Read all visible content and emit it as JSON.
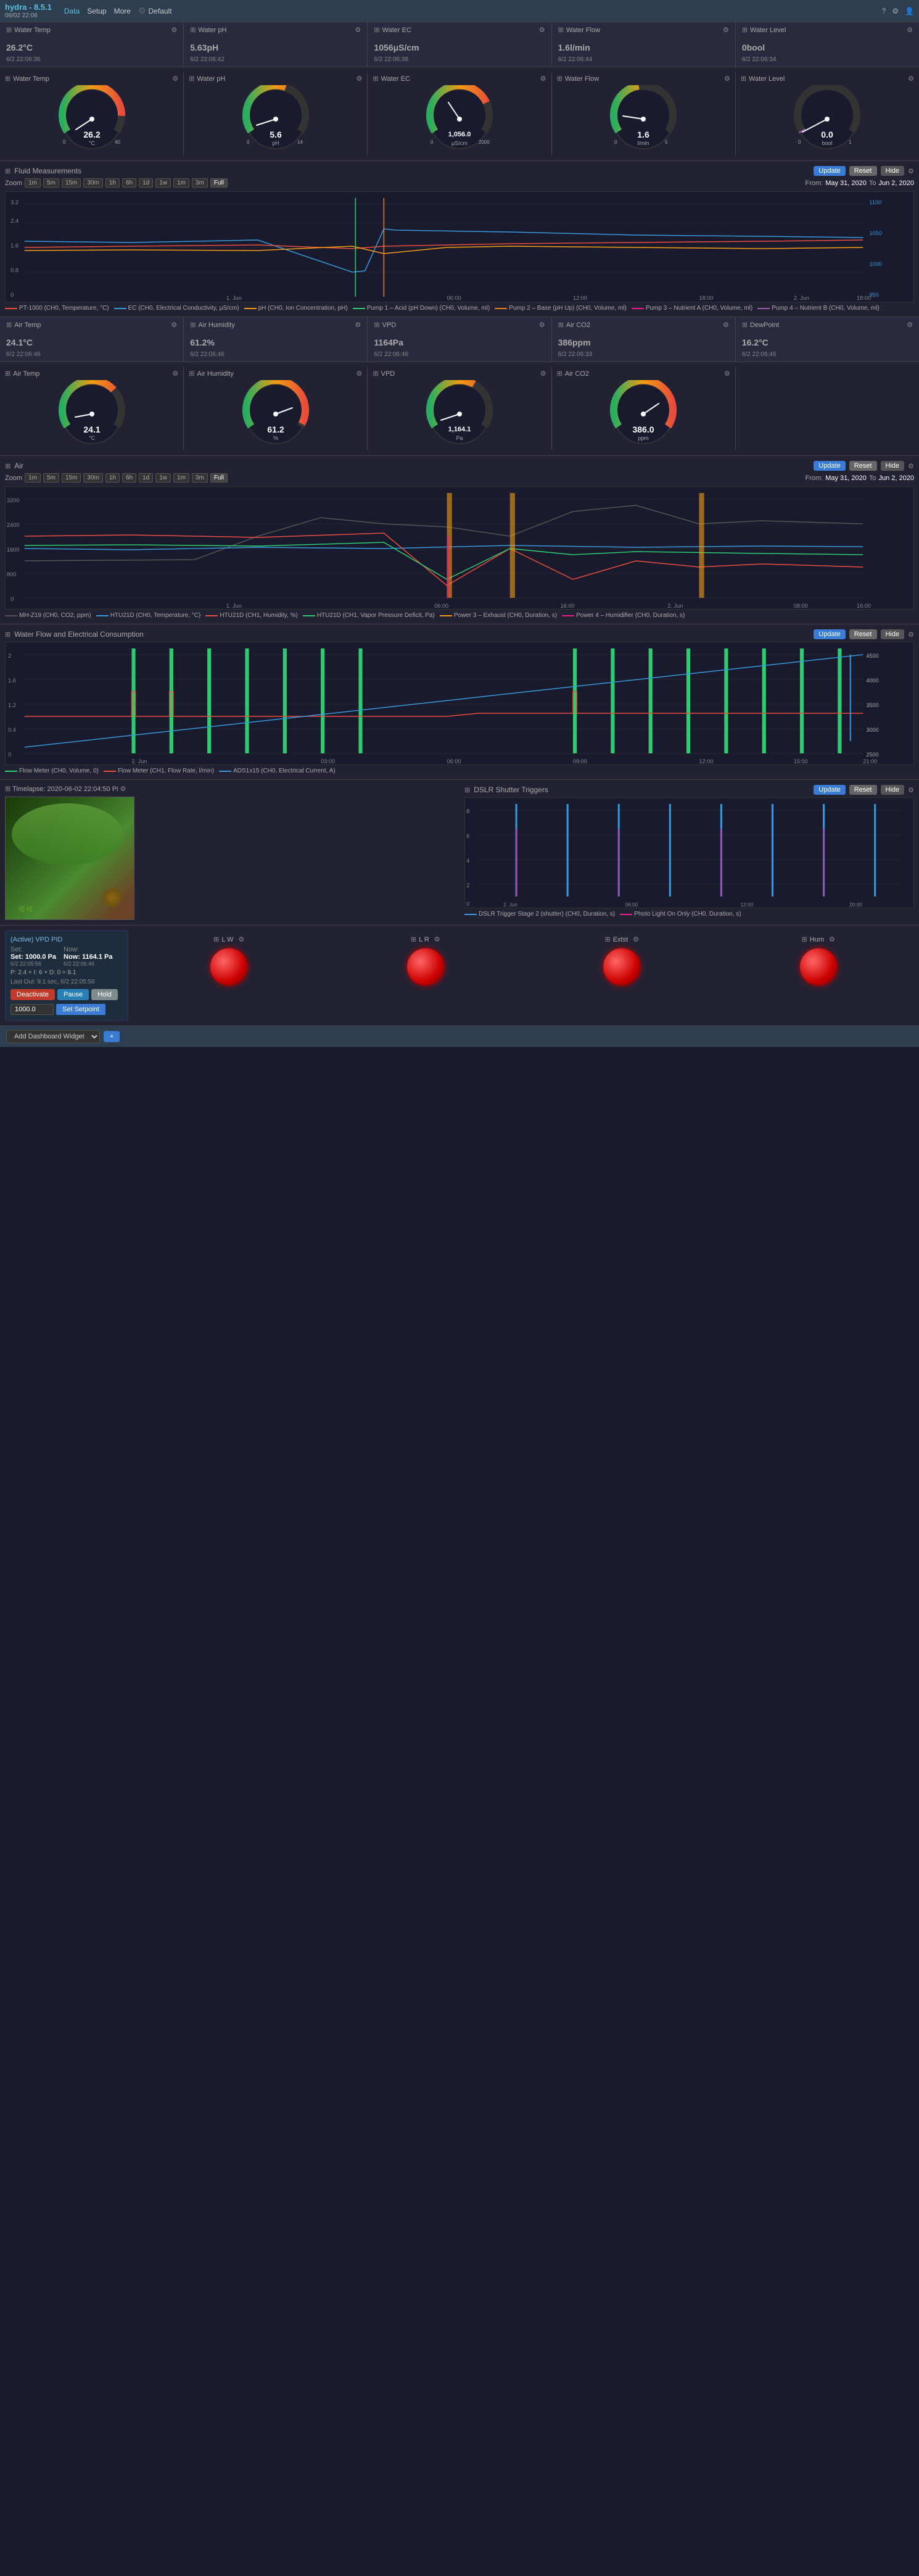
{
  "nav": {
    "brand": "hydra - 8.5.1",
    "date": "06/02 22:06",
    "data_label": "Data",
    "setup_label": "Setup",
    "more_label": "More",
    "default_label": "Default"
  },
  "top_widgets": [
    {
      "id": "water-temp",
      "label": "Water Temp",
      "value": "26.2",
      "unit": "°C",
      "time": "6/2 22:06:36"
    },
    {
      "id": "water-ph",
      "label": "Water pH",
      "value": "5.63",
      "unit": "pH",
      "time": "6/2 22:06:42"
    },
    {
      "id": "water-ec",
      "label": "Water EC",
      "value": "1056",
      "unit": "μS/cm",
      "time": "6/2 22:06:38"
    },
    {
      "id": "water-flow",
      "label": "Water Flow",
      "value": "1.6",
      "unit": "l/min",
      "time": "6/2 22:06:44"
    },
    {
      "id": "water-level",
      "label": "Water Level",
      "value": "0",
      "unit": "bool",
      "time": "6/2 22:06:34"
    }
  ],
  "gauges_water": [
    {
      "id": "g-water-temp",
      "label": "Water Temp",
      "value": "26.2",
      "min": 0,
      "max": 40,
      "color": "#e74c3c"
    },
    {
      "id": "g-water-ph",
      "label": "Water pH",
      "value": "5.6",
      "min": 0,
      "max": 14,
      "color": "#f39c12"
    },
    {
      "id": "g-water-ec",
      "label": "Water EC",
      "value": "1,056.0",
      "min": 0,
      "max": 2000,
      "color": "#3498db"
    },
    {
      "id": "g-water-flow",
      "label": "Water Flow",
      "value": "1.6",
      "min": 0,
      "max": 5,
      "color": "#2ecc71"
    },
    {
      "id": "g-water-level",
      "label": "Water Level",
      "value": "0.0",
      "min": 0,
      "max": 1,
      "color": "#9b59b6"
    }
  ],
  "fluid_chart": {
    "title": "Fluid Measurements",
    "btn_update": "Update",
    "btn_reset": "Reset",
    "btn_hide": "Hide",
    "zoom_options": [
      "1m",
      "5m",
      "15m",
      "30m",
      "1h",
      "6h",
      "1d",
      "1w",
      "1m",
      "3m",
      "Full"
    ],
    "active_zoom": "Full",
    "from": "May 31, 2020",
    "to": "Jun 2, 2020",
    "legend": [
      {
        "label": "PT-1000 (CH0, Temperature, °C)",
        "color": "#e74c3c"
      },
      {
        "label": "EC (CH0, Electrical Conductivity, μS/cm)",
        "color": "#3498db"
      },
      {
        "label": "pH (CH0, Ion Concentration, pH)",
        "color": "#f39c12"
      },
      {
        "label": "Pump 1 – Acid (pH Down) (CH0, Volume, ml)",
        "color": "#2ecc71"
      },
      {
        "label": "Pump 2 – Base (pH Up) (CH0, Volume, ml)",
        "color": "#e67e22"
      },
      {
        "label": "Pump 3 – Nutrient A (CH0, Volume, ml)",
        "color": "#e91e8c"
      },
      {
        "label": "Pump 4 – Nutrient B (CH0, Volume, ml)",
        "color": "#9b59b6"
      }
    ]
  },
  "air_widgets": [
    {
      "id": "air-temp",
      "label": "Air Temp",
      "value": "24.1",
      "unit": "°C",
      "time": "6/2 22:06:46"
    },
    {
      "id": "air-humidity",
      "label": "Air Humidity",
      "value": "61.2",
      "unit": "%",
      "time": "6/2 22:06:46"
    },
    {
      "id": "vpd",
      "label": "VPD",
      "value": "1164",
      "unit": "Pa",
      "time": "6/2 22:06:46"
    },
    {
      "id": "air-co2",
      "label": "Air CO2",
      "value": "386",
      "unit": "ppm",
      "time": "6/2 22:06:33"
    },
    {
      "id": "dewpoint",
      "label": "DewPoint",
      "value": "16.2",
      "unit": "°C",
      "time": "6/2 22:06:46"
    }
  ],
  "gauges_air": [
    {
      "id": "g-air-temp",
      "label": "Air Temp",
      "value": "24.1",
      "min": 0,
      "max": 50,
      "color": "#e74c3c"
    },
    {
      "id": "g-air-humidity",
      "label": "Air Humidity",
      "value": "61.2",
      "min": 0,
      "max": 100,
      "color": "#3498db"
    },
    {
      "id": "g-vpd",
      "label": "VPD",
      "value": "1,164.1",
      "min": 0,
      "max": 3000,
      "color": "#2ecc71"
    },
    {
      "id": "g-air-co2",
      "label": "Air CO2",
      "value": "386.0",
      "min": 0,
      "max": 600,
      "color": "#f39c12"
    }
  ],
  "air_chart": {
    "title": "Air",
    "btn_update": "Update",
    "btn_reset": "Reset",
    "btn_hide": "Hide",
    "zoom_options": [
      "1m",
      "5m",
      "15m",
      "30m",
      "1h",
      "6h",
      "1d",
      "1w",
      "1m",
      "3m",
      "Full"
    ],
    "active_zoom": "Full",
    "from": "May 31, 2020",
    "to": "Jun 2, 2020",
    "legend": [
      {
        "label": "MH-Z19 (CH0, CO2, ppm)",
        "color": "#333"
      },
      {
        "label": "HTU21D (CH0, Temperature, °C)",
        "color": "#3498db"
      },
      {
        "label": "HTU21D (CH1, Humidity, %)",
        "color": "#e74c3c"
      },
      {
        "label": "HTU21D (CH1, Vapor Pressure Deficit, Pa)",
        "color": "#2ecc71"
      },
      {
        "label": "Power 3 – Exhaust (CH0, Duration, s)",
        "color": "#f39c12"
      },
      {
        "label": "Power 4 – Humidifier (CH0, Duration, s)",
        "color": "#e91e8c"
      }
    ]
  },
  "waterflow_chart": {
    "title": "Water Flow and Electrical Consumption",
    "btn_update": "Update",
    "btn_reset": "Reset",
    "btn_hide": "Hide",
    "legend": [
      {
        "label": "Flow Meter (CH0, Volume, 0)",
        "color": "#2ecc71"
      },
      {
        "label": "Flow Meter (CH1, Flow Rate, l/min)",
        "color": "#e74c3c"
      },
      {
        "label": "ADS1x15 (CH0, Electrical Current, A)",
        "color": "#3498db"
      }
    ]
  },
  "timelapse": {
    "title": "Timelapse: 2020-06-02 22:04:50 Pi",
    "dslr_title": "DSLR Shutter Triggers",
    "btn_update": "Update",
    "btn_reset": "Reset",
    "btn_hide": "Hide",
    "legend": [
      {
        "label": "DSLR Trigger Stage 2 (shutter) (CH0, Duration, s)",
        "color": "#3498db"
      },
      {
        "label": "Photo Light On Only (CH0, Duration, s)",
        "color": "#e91e8c"
      }
    ]
  },
  "pid": {
    "title": "(Active) VPD PID",
    "set_label": "Set: 1000.0 Pa",
    "now_label": "Now: 1164.1 Pa",
    "set_time": "6/2 22:05:56",
    "now_time": "6/2 22:06:46",
    "equation": "P: 2.4 + I: 6 + D: 0 = 8.1",
    "last_out": "Last Out: 9.1 sec, 6/2 22:05:56",
    "btn_deactivate": "Deactivate",
    "btn_pause": "Pause",
    "btn_hold": "Hold",
    "setpoint_val": "1000.0",
    "btn_set": "Set Setpoint"
  },
  "led_cols": [
    {
      "id": "lw",
      "label": "L W"
    },
    {
      "id": "lr",
      "label": "L R"
    },
    {
      "id": "extst",
      "label": "Extst"
    },
    {
      "id": "hum",
      "label": "Hum"
    }
  ],
  "add_widget": {
    "label": "Add Dashboard Widget",
    "btn_label": "+"
  }
}
